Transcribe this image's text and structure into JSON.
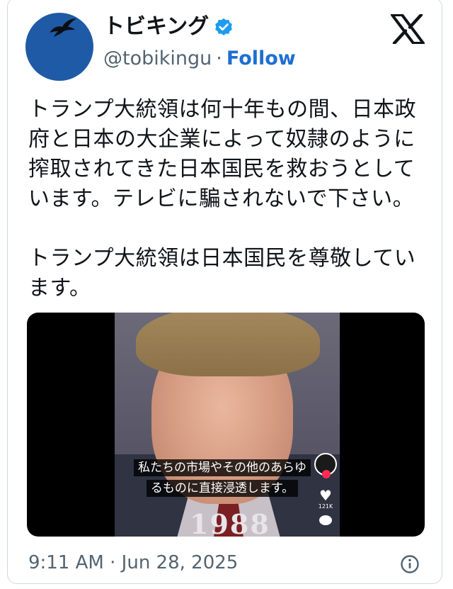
{
  "author": {
    "display_name": "トビキング",
    "handle": "@tobikingu",
    "separator": "·",
    "follow_label": "Follow",
    "verified": true
  },
  "post": {
    "paragraphs": [
      "トランプ大統領は何十年もの間、日本政府と日本の大企業によって奴隷のように搾取されてきた日本国民を救おうとしています。テレビに騙されないで下さい。",
      "トランプ大統領は日本国民を尊敬しています。"
    ]
  },
  "media": {
    "subtitle_line1": "私たちの市場やその他のあらゆ",
    "subtitle_line2": "るものに直接浸透します。",
    "year_caption": "1988",
    "like_count": "121K"
  },
  "footer": {
    "time": "9:11 AM",
    "separator": "·",
    "date": "Jun 28, 2025"
  },
  "colors": {
    "accent": "#1d6fd2",
    "avatar": "#1f5aa6",
    "verified": "#1d9bf0",
    "muted_text": "#536471"
  },
  "icons": [
    "bird-icon",
    "verified-badge-icon",
    "x-logo-icon",
    "heart-icon",
    "comment-icon",
    "info-icon"
  ]
}
